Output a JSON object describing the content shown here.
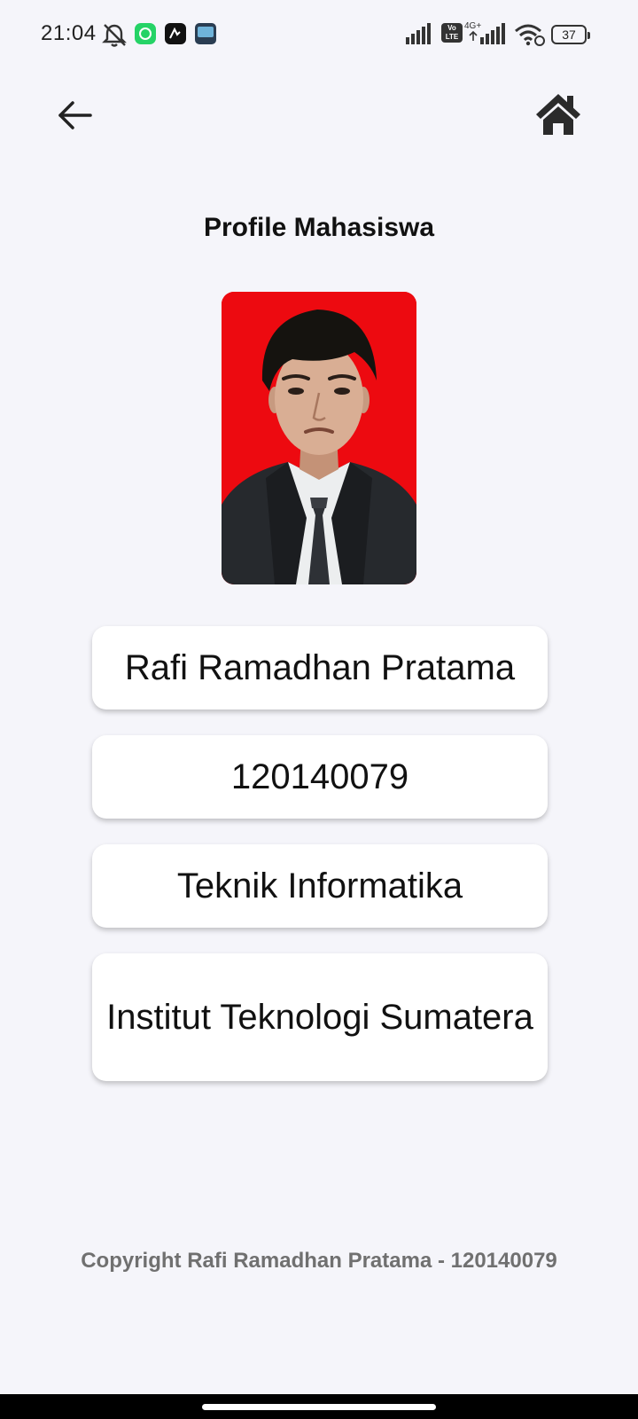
{
  "status_bar": {
    "time": "21:04",
    "network_type": "4G+",
    "volte_label": "Vo LTE",
    "battery_level": "37",
    "icons": [
      "bell-off-icon",
      "whatsapp-icon",
      "app-icon",
      "gallery-icon",
      "signal-icon",
      "volte-icon",
      "signal-icon",
      "wifi-icon",
      "battery-icon"
    ]
  },
  "nav": {
    "back_icon": "arrow-left-icon",
    "home_icon": "home-icon"
  },
  "page": {
    "title": "Profile Mahasiswa"
  },
  "profile": {
    "photo_background": "#ed0a10",
    "name": "Rafi Ramadhan Pratama",
    "nim": "120140079",
    "program": "Teknik Informatika",
    "institution": "Institut Teknologi Sumatera"
  },
  "footer": {
    "copyright": "Copyright Rafi Ramadhan Pratama - 120140079"
  },
  "colors": {
    "background": "#f5f5fa",
    "card": "#ffffff",
    "footer_text": "#707070"
  }
}
